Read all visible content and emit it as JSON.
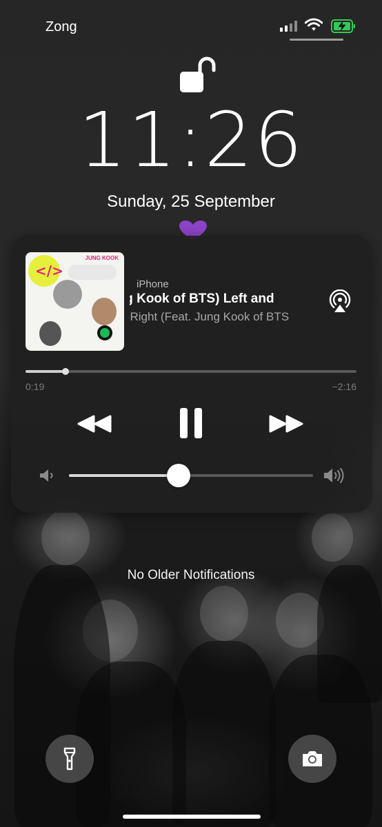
{
  "status_bar": {
    "carrier": "Zong",
    "signal_bars_active": 2,
    "signal_bars_total": 4,
    "battery_state": "charging",
    "battery_color": "#34c759"
  },
  "lock_screen": {
    "lock_icon": "unlocked-padlock-icon",
    "time": "11:26",
    "date": "Sunday, 25 September",
    "emoji": "purple-heart",
    "emoji_color": "#8e44c9"
  },
  "now_playing": {
    "album_art_artist": "JUNG KOOK",
    "source": "iPhone",
    "title": "Left and Right (Feat. Jung Kook of BTS)",
    "title_visible": "ung Kook of BTS)       Left and",
    "subtitle_visible": "l Right (Feat. Jung Kook of BTS",
    "elapsed": "0:19",
    "remaining": "−2:16",
    "progress": 0.12,
    "volume": 0.45,
    "controls": [
      "rewind-icon",
      "pause-icon",
      "fast-forward-icon"
    ],
    "airplay_icon": "airplay-icon"
  },
  "notifications": {
    "empty_text": "No Older Notifications"
  },
  "quick_actions": {
    "left": "flashlight-icon",
    "right": "camera-icon"
  }
}
